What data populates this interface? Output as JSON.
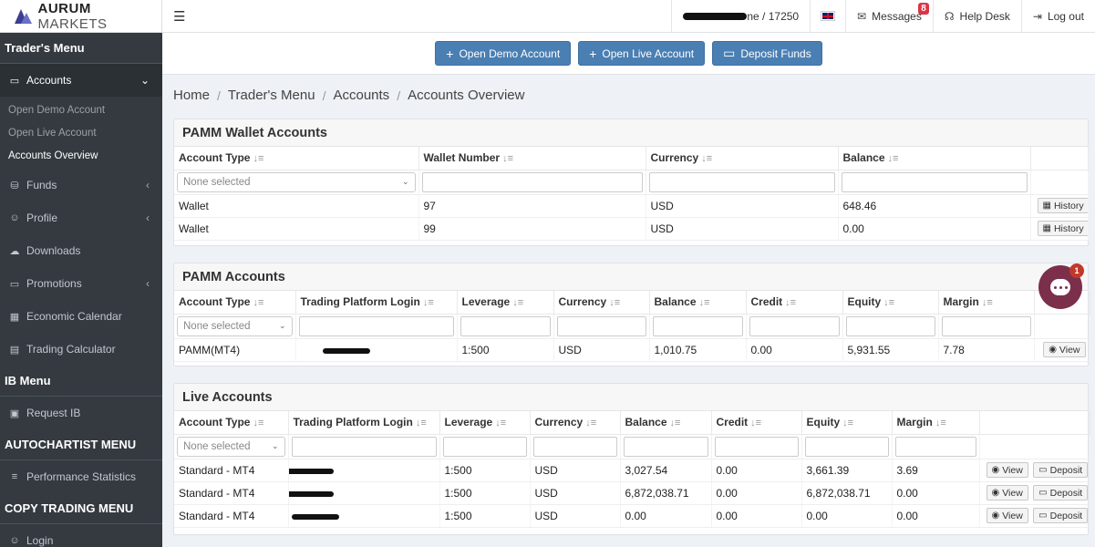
{
  "brand": {
    "name_bold": "AURUM",
    "name_light": " MARKETS"
  },
  "sidebar": {
    "traders_menu": "Trader's Menu",
    "accounts": "Accounts",
    "accounts_sub": [
      "Open Demo Account",
      "Open Live Account",
      "Accounts Overview"
    ],
    "funds": "Funds",
    "profile": "Profile",
    "downloads": "Downloads",
    "promotions": "Promotions",
    "economic_calendar": "Economic Calendar",
    "trading_calculator": "Trading Calculator",
    "ib_menu": "IB Menu",
    "request_ib": "Request IB",
    "autochartist_menu": "AUTOCHARTIST MENU",
    "performance_statistics": "Performance Statistics",
    "copy_trading_menu": "COPY TRADING MENU",
    "login": "Login"
  },
  "topbar": {
    "user_suffix": "ne / 17250",
    "messages": "Messages",
    "messages_count": "8",
    "help_desk": "Help Desk",
    "log_out": "Log out"
  },
  "actions": {
    "open_demo": "Open Demo Account",
    "open_live": "Open Live Account",
    "deposit_funds": "Deposit Funds"
  },
  "breadcrumb": [
    "Home",
    "Trader's Menu",
    "Accounts",
    "Accounts Overview"
  ],
  "wallet": {
    "title": "PAMM Wallet Accounts",
    "headers": [
      "Account Type",
      "Wallet Number",
      "Currency",
      "Balance"
    ],
    "filter_placeholder": "None selected",
    "rows": [
      {
        "type": "Wallet",
        "number": "97",
        "currency": "USD",
        "balance": "648.46"
      },
      {
        "type": "Wallet",
        "number": "99",
        "currency": "USD",
        "balance": "0.00"
      }
    ],
    "history_label": "History"
  },
  "pamm": {
    "title": "PAMM Accounts",
    "headers": [
      "Account Type",
      "Trading Platform Login",
      "Leverage",
      "Currency",
      "Balance",
      "Credit",
      "Equity",
      "Margin"
    ],
    "filter_placeholder": "None selected",
    "rows": [
      {
        "type": "PAMM(MT4)",
        "leverage": "1:500",
        "currency": "USD",
        "balance": "1,010.75",
        "credit": "0.00",
        "equity": "5,931.55",
        "margin": "7.78"
      }
    ],
    "view_label": "View"
  },
  "live": {
    "title": "Live Accounts",
    "headers": [
      "Account Type",
      "Trading Platform Login",
      "Leverage",
      "Currency",
      "Balance",
      "Credit",
      "Equity",
      "Margin"
    ],
    "filter_placeholder": "None selected",
    "rows": [
      {
        "type": "Standard - MT4",
        "leverage": "1:500",
        "currency": "USD",
        "balance": "3,027.54",
        "credit": "0.00",
        "equity": "3,661.39",
        "margin": "3.69"
      },
      {
        "type": "Standard - MT4",
        "leverage": "1:500",
        "currency": "USD",
        "balance": "6,872,038.71",
        "credit": "0.00",
        "equity": "6,872,038.71",
        "margin": "0.00"
      },
      {
        "type": "Standard - MT4",
        "leverage": "1:500",
        "currency": "USD",
        "balance": "0.00",
        "credit": "0.00",
        "equity": "0.00",
        "margin": "0.00"
      }
    ],
    "view_label": "View",
    "deposit_label": "Deposit"
  },
  "chat": {
    "badge": "1"
  },
  "colors": {
    "sidebar_bg": "#343a40",
    "primary_button": "#4a7fb3",
    "badge": "#dc3545",
    "chat": "#7b2f4b"
  }
}
